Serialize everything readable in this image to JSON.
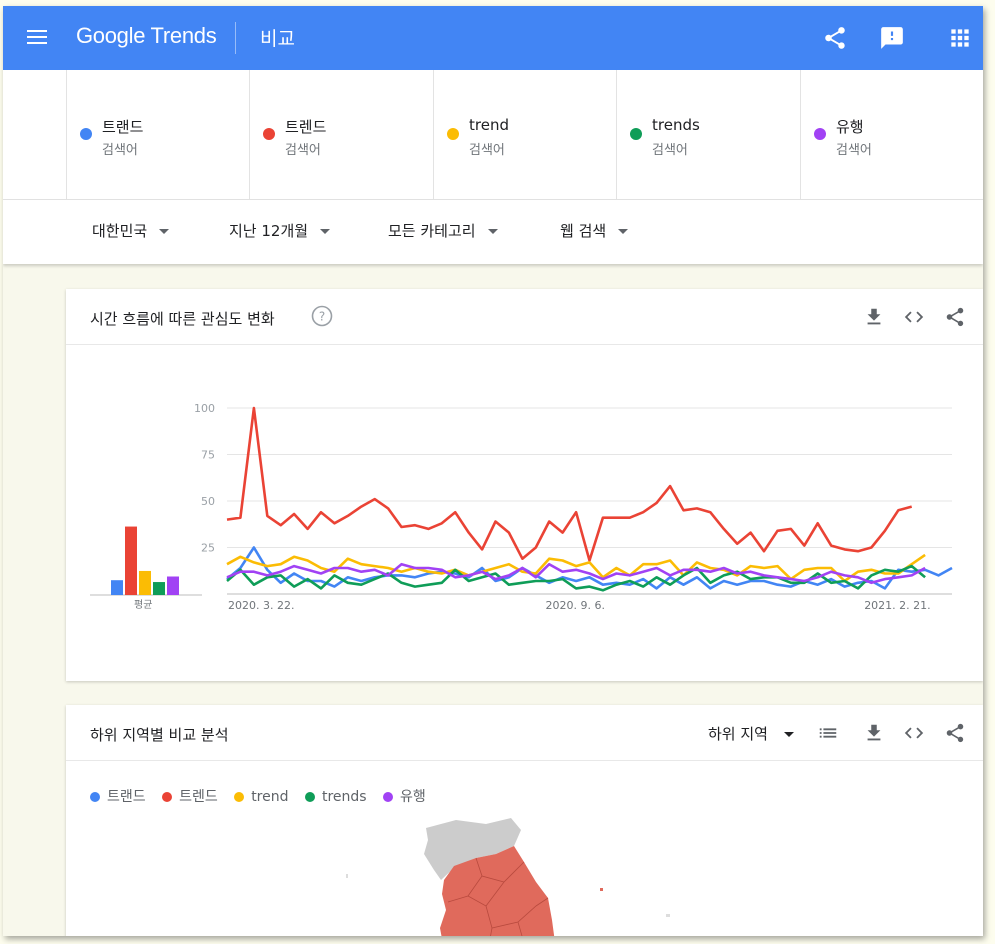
{
  "header": {
    "logo_text": "Google Trends",
    "page_title": "비교"
  },
  "terms": [
    {
      "name": "트랜드",
      "sub": "검색어",
      "color": "#4285f4"
    },
    {
      "name": "트렌드",
      "sub": "검색어",
      "color": "#ea4335"
    },
    {
      "name": "trend",
      "sub": "검색어",
      "color": "#fbbc04"
    },
    {
      "name": "trends",
      "sub": "검색어",
      "color": "#0f9d58"
    },
    {
      "name": "유행",
      "sub": "검색어",
      "color": "#a142f4"
    }
  ],
  "filters": {
    "region": "대한민국",
    "period": "지난 12개월",
    "category": "모든 카테고리",
    "search_type": "웹 검색"
  },
  "interest_over_time": {
    "title": "시간 흐름에 따른 관심도 변화",
    "avg_label": "평균"
  },
  "subregion": {
    "title": "하위 지역별 비교 분석",
    "select_label": "하위 지역"
  },
  "chart_data": {
    "type": "line",
    "ylim": [
      0,
      100
    ],
    "y_ticks": [
      "100",
      "75",
      "50",
      "25"
    ],
    "x_tick_labels": [
      "2020. 3. 22.",
      "2020. 9. 6.",
      "2021. 2. 21."
    ],
    "x_tick_index": [
      0,
      24,
      48
    ],
    "grid": true,
    "averages": [
      8,
      37,
      13,
      7,
      10
    ],
    "series": [
      {
        "name": "트랜드",
        "color": "#4285f4",
        "values": [
          8,
          14,
          25,
          13,
          6,
          11,
          7,
          7,
          4,
          9,
          7,
          9,
          10,
          10,
          9,
          11,
          12,
          11,
          9,
          14,
          7,
          9,
          14,
          10,
          6,
          9,
          7,
          9,
          5,
          6,
          5,
          8,
          3,
          9,
          5,
          9,
          3,
          7,
          5,
          7,
          7,
          5,
          4,
          7,
          5,
          8,
          4,
          6,
          7,
          3,
          13,
          12,
          13,
          10,
          14
        ]
      },
      {
        "name": "트렌드",
        "color": "#ea4335",
        "values": [
          40,
          41,
          100,
          42,
          37,
          43,
          35,
          44,
          38,
          42,
          47,
          51,
          46,
          36,
          37,
          35,
          38,
          44,
          33,
          24,
          39,
          33,
          19,
          25,
          39,
          33,
          44,
          18,
          41,
          41,
          41,
          44,
          49,
          58,
          45,
          46,
          44,
          35,
          27,
          33,
          23,
          34,
          35,
          26,
          38,
          26,
          24,
          23,
          25,
          34,
          45,
          47
        ]
      },
      {
        "name": "trend",
        "color": "#fbbc04",
        "values": [
          16,
          20,
          17,
          15,
          16,
          20,
          18,
          14,
          12,
          19,
          16,
          15,
          14,
          12,
          14,
          12,
          11,
          13,
          10,
          12,
          14,
          16,
          12,
          11,
          19,
          18,
          15,
          17,
          9,
          14,
          10,
          16,
          16,
          18,
          10,
          17,
          14,
          13,
          10,
          15,
          14,
          15,
          8,
          13,
          14,
          14,
          7,
          12,
          13,
          11,
          11,
          16,
          21
        ]
      },
      {
        "name": "trends",
        "color": "#0f9d58",
        "values": [
          7,
          13,
          5,
          9,
          10,
          4,
          8,
          3,
          10,
          6,
          5,
          8,
          11,
          6,
          4,
          5,
          6,
          13,
          7,
          9,
          11,
          5,
          6,
          7,
          7,
          8,
          3,
          4,
          2,
          5,
          7,
          4,
          9,
          5,
          10,
          14,
          6,
          10,
          12,
          8,
          9,
          9,
          6,
          6,
          11,
          6,
          7,
          3,
          10,
          13,
          12,
          15,
          9
        ]
      },
      {
        "name": "유행",
        "color": "#a142f4",
        "values": [
          9,
          12,
          12,
          10,
          12,
          15,
          13,
          11,
          14,
          14,
          12,
          13,
          10,
          16,
          14,
          14,
          13,
          9,
          10,
          12,
          8,
          10,
          14,
          9,
          16,
          12,
          13,
          11,
          8,
          11,
          10,
          12,
          14,
          10,
          13,
          13,
          12,
          14,
          11,
          12,
          10,
          9,
          8,
          7,
          9,
          12,
          10,
          9,
          6,
          8,
          9,
          10,
          14
        ]
      }
    ]
  }
}
